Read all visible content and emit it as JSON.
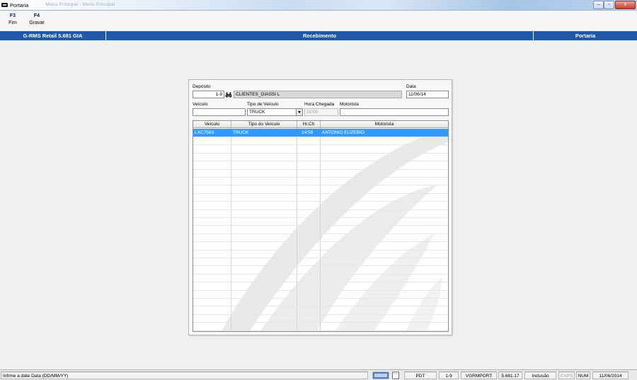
{
  "window": {
    "title": "Portaria",
    "faded_caption": "· Menu Principal · Menu Principal"
  },
  "toolbar": {
    "keys": [
      {
        "key": "F3",
        "label": "Fim"
      },
      {
        "key": "F4",
        "label": "Gravar"
      }
    ]
  },
  "header": {
    "app": "G-RMS Retail 5.681 GIA",
    "screen": "Recebimento",
    "module": "Portaria"
  },
  "form": {
    "deposito_label": "Depósito",
    "deposito_code": "1-9",
    "deposito_name": "CLIENTES_GIASSI L",
    "data_label": "Data",
    "data_value": "11/06/14",
    "veiculo_label": "Veículo",
    "veiculo_value": "",
    "tipo_label": "Tipo de Veículo",
    "tipo_value": "TRUCK",
    "hora_label": "Hora Chegada",
    "hora_value": "15:00",
    "motorista_label": "Motorista",
    "motorista_value": ""
  },
  "grid": {
    "columns": [
      "Veículo",
      "Tipo do Veículo",
      "Hr.Ch",
      "Motorista"
    ],
    "rows": [
      {
        "veiculo": "LXC7583",
        "tipo": "TRUCK",
        "hora": "14:59",
        "motorista": "ANTONIO EUZEBIO"
      }
    ]
  },
  "status": {
    "message": "Infrme a date Data (DD/MM/YY)",
    "pdt": "PDT",
    "deposit": "1-9",
    "program": "VGRMPORT",
    "version": "5.681.17",
    "mode": "Inclusão",
    "caps": "CAPS",
    "num": "NUM",
    "date": "11/06/2014"
  },
  "colors": {
    "header_blue": "#1f59a7",
    "selection_blue": "#3399ff"
  }
}
